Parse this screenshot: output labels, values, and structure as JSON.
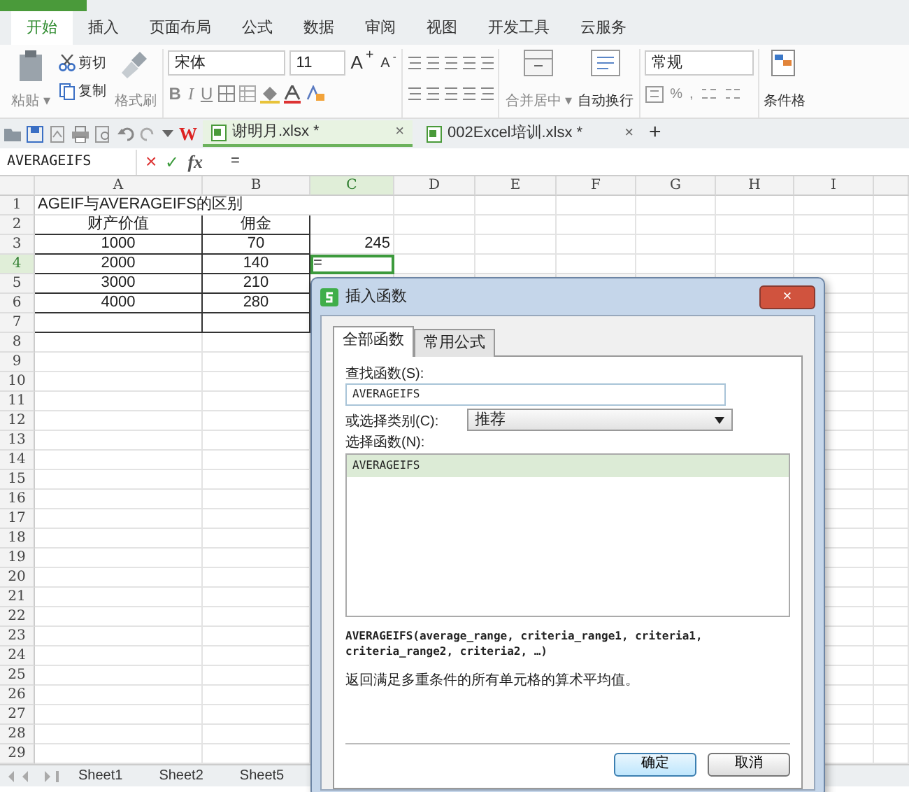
{
  "ribbon_tabs": [
    {
      "label": "开始",
      "selected": true
    },
    {
      "label": "插入",
      "selected": false
    },
    {
      "label": "页面布局",
      "selected": false
    },
    {
      "label": "公式",
      "selected": false
    },
    {
      "label": "数据",
      "selected": false
    },
    {
      "label": "审阅",
      "selected": false
    },
    {
      "label": "视图",
      "selected": false
    },
    {
      "label": "开发工具",
      "selected": false
    },
    {
      "label": "云服务",
      "selected": false
    }
  ],
  "ribbon": {
    "paste": "粘贴",
    "paste_menu": "▾",
    "merge_menu": "▾",
    "cut": "剪切",
    "copy": "复制",
    "format_painter": "格式刷",
    "font_name": "宋体",
    "font_size": "11",
    "grow_font": "A$^{+}$",
    "shrink_font": "A$^{-}$",
    "bold": "B",
    "italic": "I",
    "underline": "U",
    "merge_center": "合并居中",
    "wrap_text": "自动换行",
    "number_format": "常规",
    "percent": "%",
    "comma": ",",
    "conditional_format": "条件格"
  },
  "quick_access": {
    "logo": "W"
  },
  "doc_tabs": [
    {
      "title": "谢明月.xlsx *",
      "close": "×",
      "selected": true
    },
    {
      "title": "002Excel培训.xlsx *",
      "close": "×",
      "selected": false
    }
  ],
  "new_tab": "+",
  "formula_bar": {
    "name_box": "AVERAGEIFS",
    "cancel": "×",
    "enter": "✓",
    "fx": "fx",
    "formula": "="
  },
  "columns": [
    {
      "label": "A",
      "selected": false
    },
    {
      "label": "B",
      "selected": false
    },
    {
      "label": "C",
      "selected": true
    },
    {
      "label": "D",
      "selected": false
    },
    {
      "label": "E",
      "selected": false
    },
    {
      "label": "F",
      "selected": false
    },
    {
      "label": "G",
      "selected": false
    },
    {
      "label": "H",
      "selected": false
    },
    {
      "label": "I",
      "selected": false
    }
  ],
  "rows": [
    {
      "header": "1",
      "selected": false,
      "bordered": false,
      "cells": [
        "AGEIF与AVERAGEIFS的区别"
      ]
    },
    {
      "header": "2",
      "selected": false,
      "bordered": true,
      "cells": [
        "财产价值",
        "佣金"
      ]
    },
    {
      "header": "3",
      "selected": false,
      "bordered": true,
      "cells": [
        "1000",
        "70",
        "245"
      ]
    },
    {
      "header": "4",
      "selected": true,
      "bordered": true,
      "cells": [
        "2000",
        "140",
        "="
      ]
    },
    {
      "header": "5",
      "selected": false,
      "bordered": true,
      "cells": [
        "3000",
        "210"
      ]
    },
    {
      "header": "6",
      "selected": false,
      "bordered": true,
      "cells": [
        "4000",
        "280"
      ]
    },
    {
      "header": "7",
      "selected": false,
      "bordered": true,
      "cells": []
    },
    {
      "header": "8",
      "selected": false,
      "bordered": false,
      "cells": []
    },
    {
      "header": "9",
      "selected": false,
      "bordered": false,
      "cells": []
    },
    {
      "header": "10",
      "selected": false,
      "bordered": false,
      "cells": []
    },
    {
      "header": "11",
      "selected": false,
      "bordered": false,
      "cells": []
    },
    {
      "header": "12",
      "selected": false,
      "bordered": false,
      "cells": []
    },
    {
      "header": "13",
      "selected": false,
      "bordered": false,
      "cells": []
    },
    {
      "header": "14",
      "selected": false,
      "bordered": false,
      "cells": []
    },
    {
      "header": "15",
      "selected": false,
      "bordered": false,
      "cells": []
    },
    {
      "header": "16",
      "selected": false,
      "bordered": false,
      "cells": []
    },
    {
      "header": "17",
      "selected": false,
      "bordered": false,
      "cells": []
    },
    {
      "header": "18",
      "selected": false,
      "bordered": false,
      "cells": []
    },
    {
      "header": "19",
      "selected": false,
      "bordered": false,
      "cells": []
    },
    {
      "header": "20",
      "selected": false,
      "bordered": false,
      "cells": []
    },
    {
      "header": "21",
      "selected": false,
      "bordered": false,
      "cells": []
    },
    {
      "header": "22",
      "selected": false,
      "bordered": false,
      "cells": []
    },
    {
      "header": "23",
      "selected": false,
      "bordered": false,
      "cells": []
    },
    {
      "header": "24",
      "selected": false,
      "bordered": false,
      "cells": []
    },
    {
      "header": "25",
      "selected": false,
      "bordered": false,
      "cells": []
    },
    {
      "header": "26",
      "selected": false,
      "bordered": false,
      "cells": []
    },
    {
      "header": "27",
      "selected": false,
      "bordered": false,
      "cells": []
    },
    {
      "header": "28",
      "selected": false,
      "bordered": false,
      "cells": []
    },
    {
      "header": "29",
      "selected": false,
      "bordered": false,
      "cells": []
    }
  ],
  "sheet_tabs": [
    "Sheet1",
    "Sheet2",
    "Sheet5"
  ],
  "dialog": {
    "title": "插入函数",
    "close": "×",
    "tabs": [
      {
        "label": "全部函数",
        "selected": true
      },
      {
        "label": "常用公式",
        "selected": false
      }
    ],
    "search_label": "查找函数(S):",
    "search_value": "AVERAGEIFS",
    "category_label": "或选择类别(C):",
    "category_value": "推荐",
    "list_label": "选择函数(N):",
    "functions": [
      {
        "name": "AVERAGEIFS",
        "selected": true
      }
    ],
    "signature": "AVERAGEIFS(average_range, criteria_range1, criteria1, criteria_range2, criteria2, …)",
    "description": "返回满足多重条件的所有单元格的算术平均值。",
    "ok": "确定",
    "cancel": "取消"
  }
}
